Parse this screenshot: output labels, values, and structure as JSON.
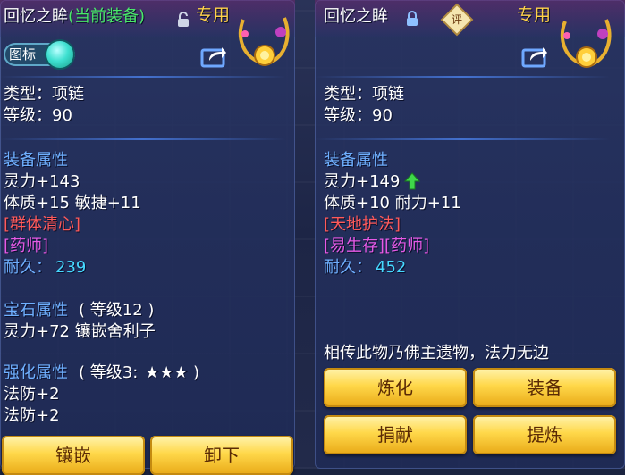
{
  "left_panel": {
    "item_name": "回忆之眸",
    "equip_status": "(当前装备)",
    "exclusive_tag": "专用",
    "icon_toggle_label": "图标",
    "type_label": "类型：项链",
    "level_label": "等级：90",
    "equip_attr_title": "装备属性",
    "stat_line_1": "灵力+143",
    "stat_line_2": "体质+15 敏捷+11",
    "special_effect": "[群体清心]",
    "sect_requirement": "[药师]",
    "durability_label": "耐久：",
    "durability_value": "239",
    "gem_attr_title": "宝石属性",
    "gem_level": "( 等级12 )",
    "gem_stat": "灵力+72 镶嵌舍利子",
    "enhance_title": "强化属性",
    "enhance_level": "( 等级3:",
    "enhance_stars": "★★★",
    "enhance_close": " )",
    "enhance_line_1": "法防+2",
    "enhance_line_2": "法防+2",
    "buttons": {
      "inlay": "镶嵌",
      "unequip": "卸下"
    }
  },
  "right_panel": {
    "item_name": "回忆之眸",
    "rating_badge": "评",
    "exclusive_tag": "专用",
    "type_label": "类型：项链",
    "level_label": "等级：90",
    "equip_attr_title": "装备属性",
    "stat_line_1": "灵力+149",
    "stat_line_2": "体质+10 耐力+11",
    "special_effect": "[天地护法]",
    "sect_requirement": "[易生存][药师]",
    "durability_label": "耐久：",
    "durability_value": "452",
    "description": "相传此物乃佛主遗物，法力无边",
    "buttons": {
      "refine": "炼化",
      "equip": "装备",
      "donate": "捐献",
      "extract": "提炼"
    }
  },
  "colors": {
    "name_white": "#ffffff",
    "equip_status_green": "#4be86a",
    "exclusive_gold": "#ffd24a",
    "attr_title_blue": "#6fb0ff",
    "effect_red": "#ff5a5a",
    "sect_purple": "#e65ae6",
    "durability_cyan": "#46d8ff",
    "button_gold": "#ffd84a"
  },
  "icons": {
    "lock_open": "unlocked-icon",
    "lock_closed": "locked-icon",
    "share": "share-icon",
    "necklace": "necklace-icon",
    "stat_up": "up-arrow-icon"
  }
}
